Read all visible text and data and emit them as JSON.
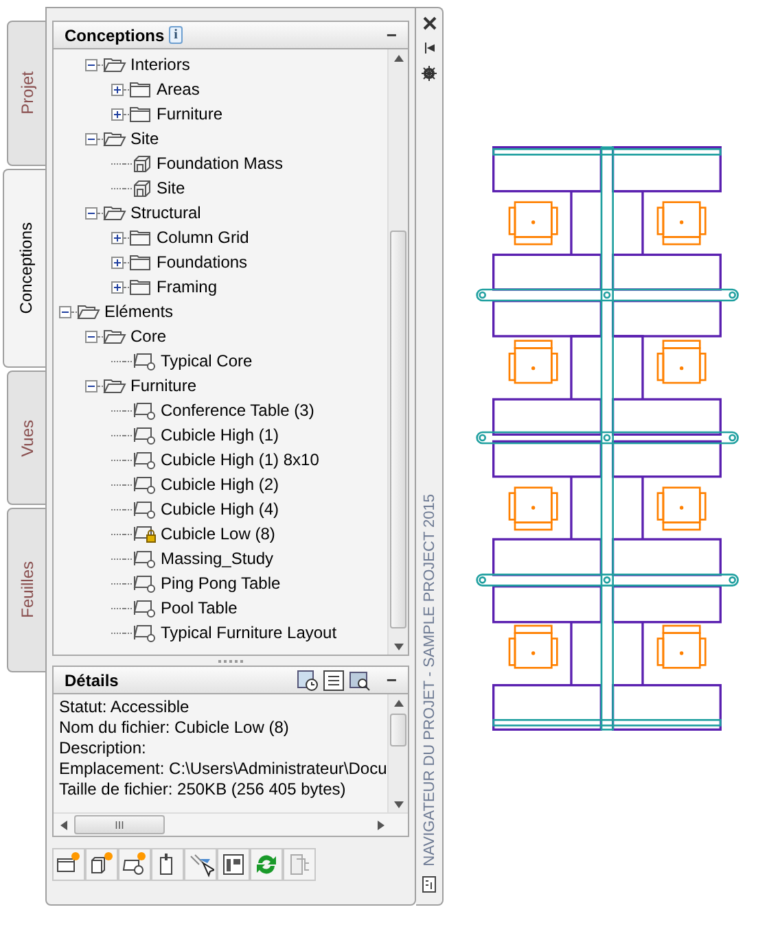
{
  "side_tabs": [
    {
      "label": "Projet",
      "selected": false
    },
    {
      "label": "Conceptions",
      "selected": true
    },
    {
      "label": "Vues",
      "selected": false
    },
    {
      "label": "Feuilles",
      "selected": false
    }
  ],
  "tree_panel": {
    "title": "Conceptions",
    "info_badge": "i",
    "collapse": "−"
  },
  "tree": [
    {
      "kind": "continuation",
      "children": [
        {
          "kind": "folder",
          "label": "Interiors",
          "expanded": true,
          "children": [
            {
              "kind": "folder",
              "label": "Areas",
              "expanded": false
            },
            {
              "kind": "folder",
              "label": "Furniture",
              "expanded": false
            }
          ]
        },
        {
          "kind": "folder",
          "label": "Site",
          "expanded": true,
          "children": [
            {
              "kind": "mass",
              "label": "Foundation Mass"
            },
            {
              "kind": "mass",
              "label": "Site"
            }
          ]
        },
        {
          "kind": "folder",
          "label": "Structural",
          "expanded": true,
          "children": [
            {
              "kind": "folder",
              "label": "Column Grid",
              "expanded": false
            },
            {
              "kind": "folder",
              "label": "Foundations",
              "expanded": false
            },
            {
              "kind": "folder",
              "label": "Framing",
              "expanded": false
            }
          ]
        }
      ]
    },
    {
      "kind": "folder",
      "label": "Eléments",
      "expanded": true,
      "children": [
        {
          "kind": "folder",
          "label": "Core",
          "expanded": true,
          "children": [
            {
              "kind": "element",
              "label": "Typical Core",
              "locked": false
            }
          ]
        },
        {
          "kind": "folder",
          "label": "Furniture",
          "expanded": true,
          "children": [
            {
              "kind": "element",
              "label": "Conference Table (3)",
              "locked": false
            },
            {
              "kind": "element",
              "label": "Cubicle High (1)",
              "locked": false
            },
            {
              "kind": "element",
              "label": "Cubicle High (1) 8x10",
              "locked": false
            },
            {
              "kind": "element",
              "label": "Cubicle High (2)",
              "locked": false
            },
            {
              "kind": "element",
              "label": "Cubicle High (4)",
              "locked": false
            },
            {
              "kind": "element",
              "label": "Cubicle Low (8)",
              "locked": true
            },
            {
              "kind": "element",
              "label": "Massing_Study",
              "locked": false
            },
            {
              "kind": "element",
              "label": "Ping Pong Table",
              "locked": false
            },
            {
              "kind": "element",
              "label": "Pool Table",
              "locked": false
            },
            {
              "kind": "element",
              "label": "Typical Furniture Layout",
              "locked": false
            }
          ]
        }
      ]
    }
  ],
  "details_panel": {
    "title": "Détails",
    "collapse": "−",
    "lines": [
      "Statut: Accessible",
      "Nom du fichier: Cubicle Low (8)",
      "Description:",
      "Emplacement: C:\\Users\\Administrateur\\Docu",
      "Taille de fichier: 250KB (256 405 bytes)"
    ],
    "scroll_grip": "III"
  },
  "palette_title": "NAVIGATEUR DU PROJET - SAMPLE PROJECT 2015"
}
